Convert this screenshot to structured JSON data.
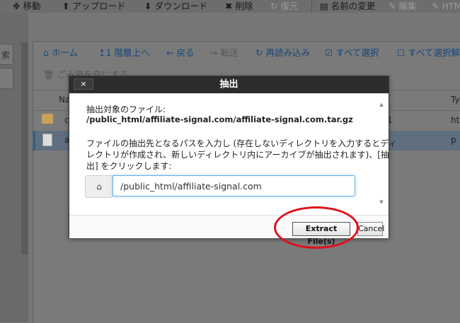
{
  "toolbar": {
    "items": [
      {
        "icon": "move-icon",
        "glyph": "✥",
        "label": "移動",
        "enabled": true
      },
      {
        "icon": "upload-icon",
        "glyph": "⬆",
        "label": "アップロード",
        "enabled": true
      },
      {
        "icon": "download-icon",
        "glyph": "⬇",
        "label": "ダウンロード",
        "enabled": true
      },
      {
        "icon": "delete-icon",
        "glyph": "✖",
        "label": "削除",
        "enabled": true
      },
      {
        "icon": "restore-icon",
        "glyph": "↻",
        "label": "復元",
        "enabled": false
      },
      {
        "icon": "rename-icon",
        "glyph": "▤",
        "label": "名前の変更",
        "enabled": true
      },
      {
        "icon": "edit-icon",
        "glyph": "✎",
        "label": "編集",
        "enabled": false
      },
      {
        "icon": "html-icon",
        "glyph": "✎",
        "label": "HTM",
        "enabled": false
      }
    ]
  },
  "sidebar": {
    "box_label": "索"
  },
  "nav": {
    "home": "ホーム",
    "up": "1 階層上へ",
    "back": "戻る",
    "forward": "転送",
    "reload": "再読み込み",
    "select_all": "すべて選択",
    "deselect_all": "すべて選択解",
    "empty_trash": "ごみ箱を空にする"
  },
  "table": {
    "header_name": "Na",
    "header_type": "Ty",
    "rows": [
      {
        "name": "c",
        "size": "1",
        "type": "ht",
        "icon": "folder-icon",
        "selected": false
      },
      {
        "name": "a",
        "size": "",
        "type": "p",
        "icon": "archive-file-icon",
        "selected": true
      }
    ]
  },
  "dialog": {
    "title": "抽出",
    "close_label": "×",
    "target_label": "抽出対象のファイル:",
    "target_path": "/public_html/affiliate-signal.com/affiliate-signal.com.tar.gz",
    "instruction_line1": "ファイルの抽出先となるパスを入力し (存在しないディレクトリを入力するとディ",
    "instruction_line2": "レクトリが作成され、新しいディレクトリ内にアーカイブが抽出されます)、[抽",
    "instruction_line3": "出] をクリックします:",
    "path_value": "/public_html/affiliate-signal.com",
    "extract_button": "Extract File(s)",
    "cancel_button": "Cancel"
  },
  "colors": {
    "accent": "#15477a",
    "annotation": "#e0101a"
  }
}
